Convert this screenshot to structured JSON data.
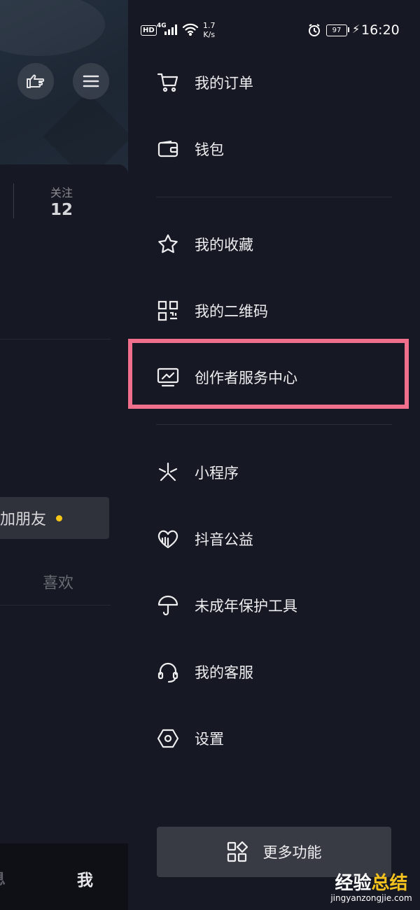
{
  "status_bar": {
    "hd": "HD",
    "network": "4G",
    "speed_value": "1.7",
    "speed_unit": "K/s",
    "battery": "97",
    "time": "16:20"
  },
  "profile": {
    "following_label": "关注",
    "following_count": "12",
    "add_friends_label": "加朋友",
    "likes_tab_label": "喜欢"
  },
  "bottom_nav": {
    "messages_label": "息",
    "me_label": "我"
  },
  "drawer": {
    "items": [
      {
        "label": "我的订单",
        "icon": "cart-icon"
      },
      {
        "label": "钱包",
        "icon": "wallet-icon"
      },
      {
        "label": "我的收藏",
        "icon": "star-icon"
      },
      {
        "label": "我的二维码",
        "icon": "qrcode-icon"
      },
      {
        "label": "创作者服务中心",
        "icon": "creator-center-icon"
      },
      {
        "label": "小程序",
        "icon": "mini-program-icon"
      },
      {
        "label": "抖音公益",
        "icon": "charity-heart-icon"
      },
      {
        "label": "未成年保护工具",
        "icon": "umbrella-icon"
      },
      {
        "label": "我的客服",
        "icon": "headset-icon"
      },
      {
        "label": "设置",
        "icon": "settings-hexagon-icon"
      }
    ],
    "more_label": "更多功能"
  },
  "highlight_color": "#ef6f8d",
  "watermark": {
    "text_a": "经验",
    "text_b": "总结",
    "url": "jingyanzongjie.com"
  }
}
